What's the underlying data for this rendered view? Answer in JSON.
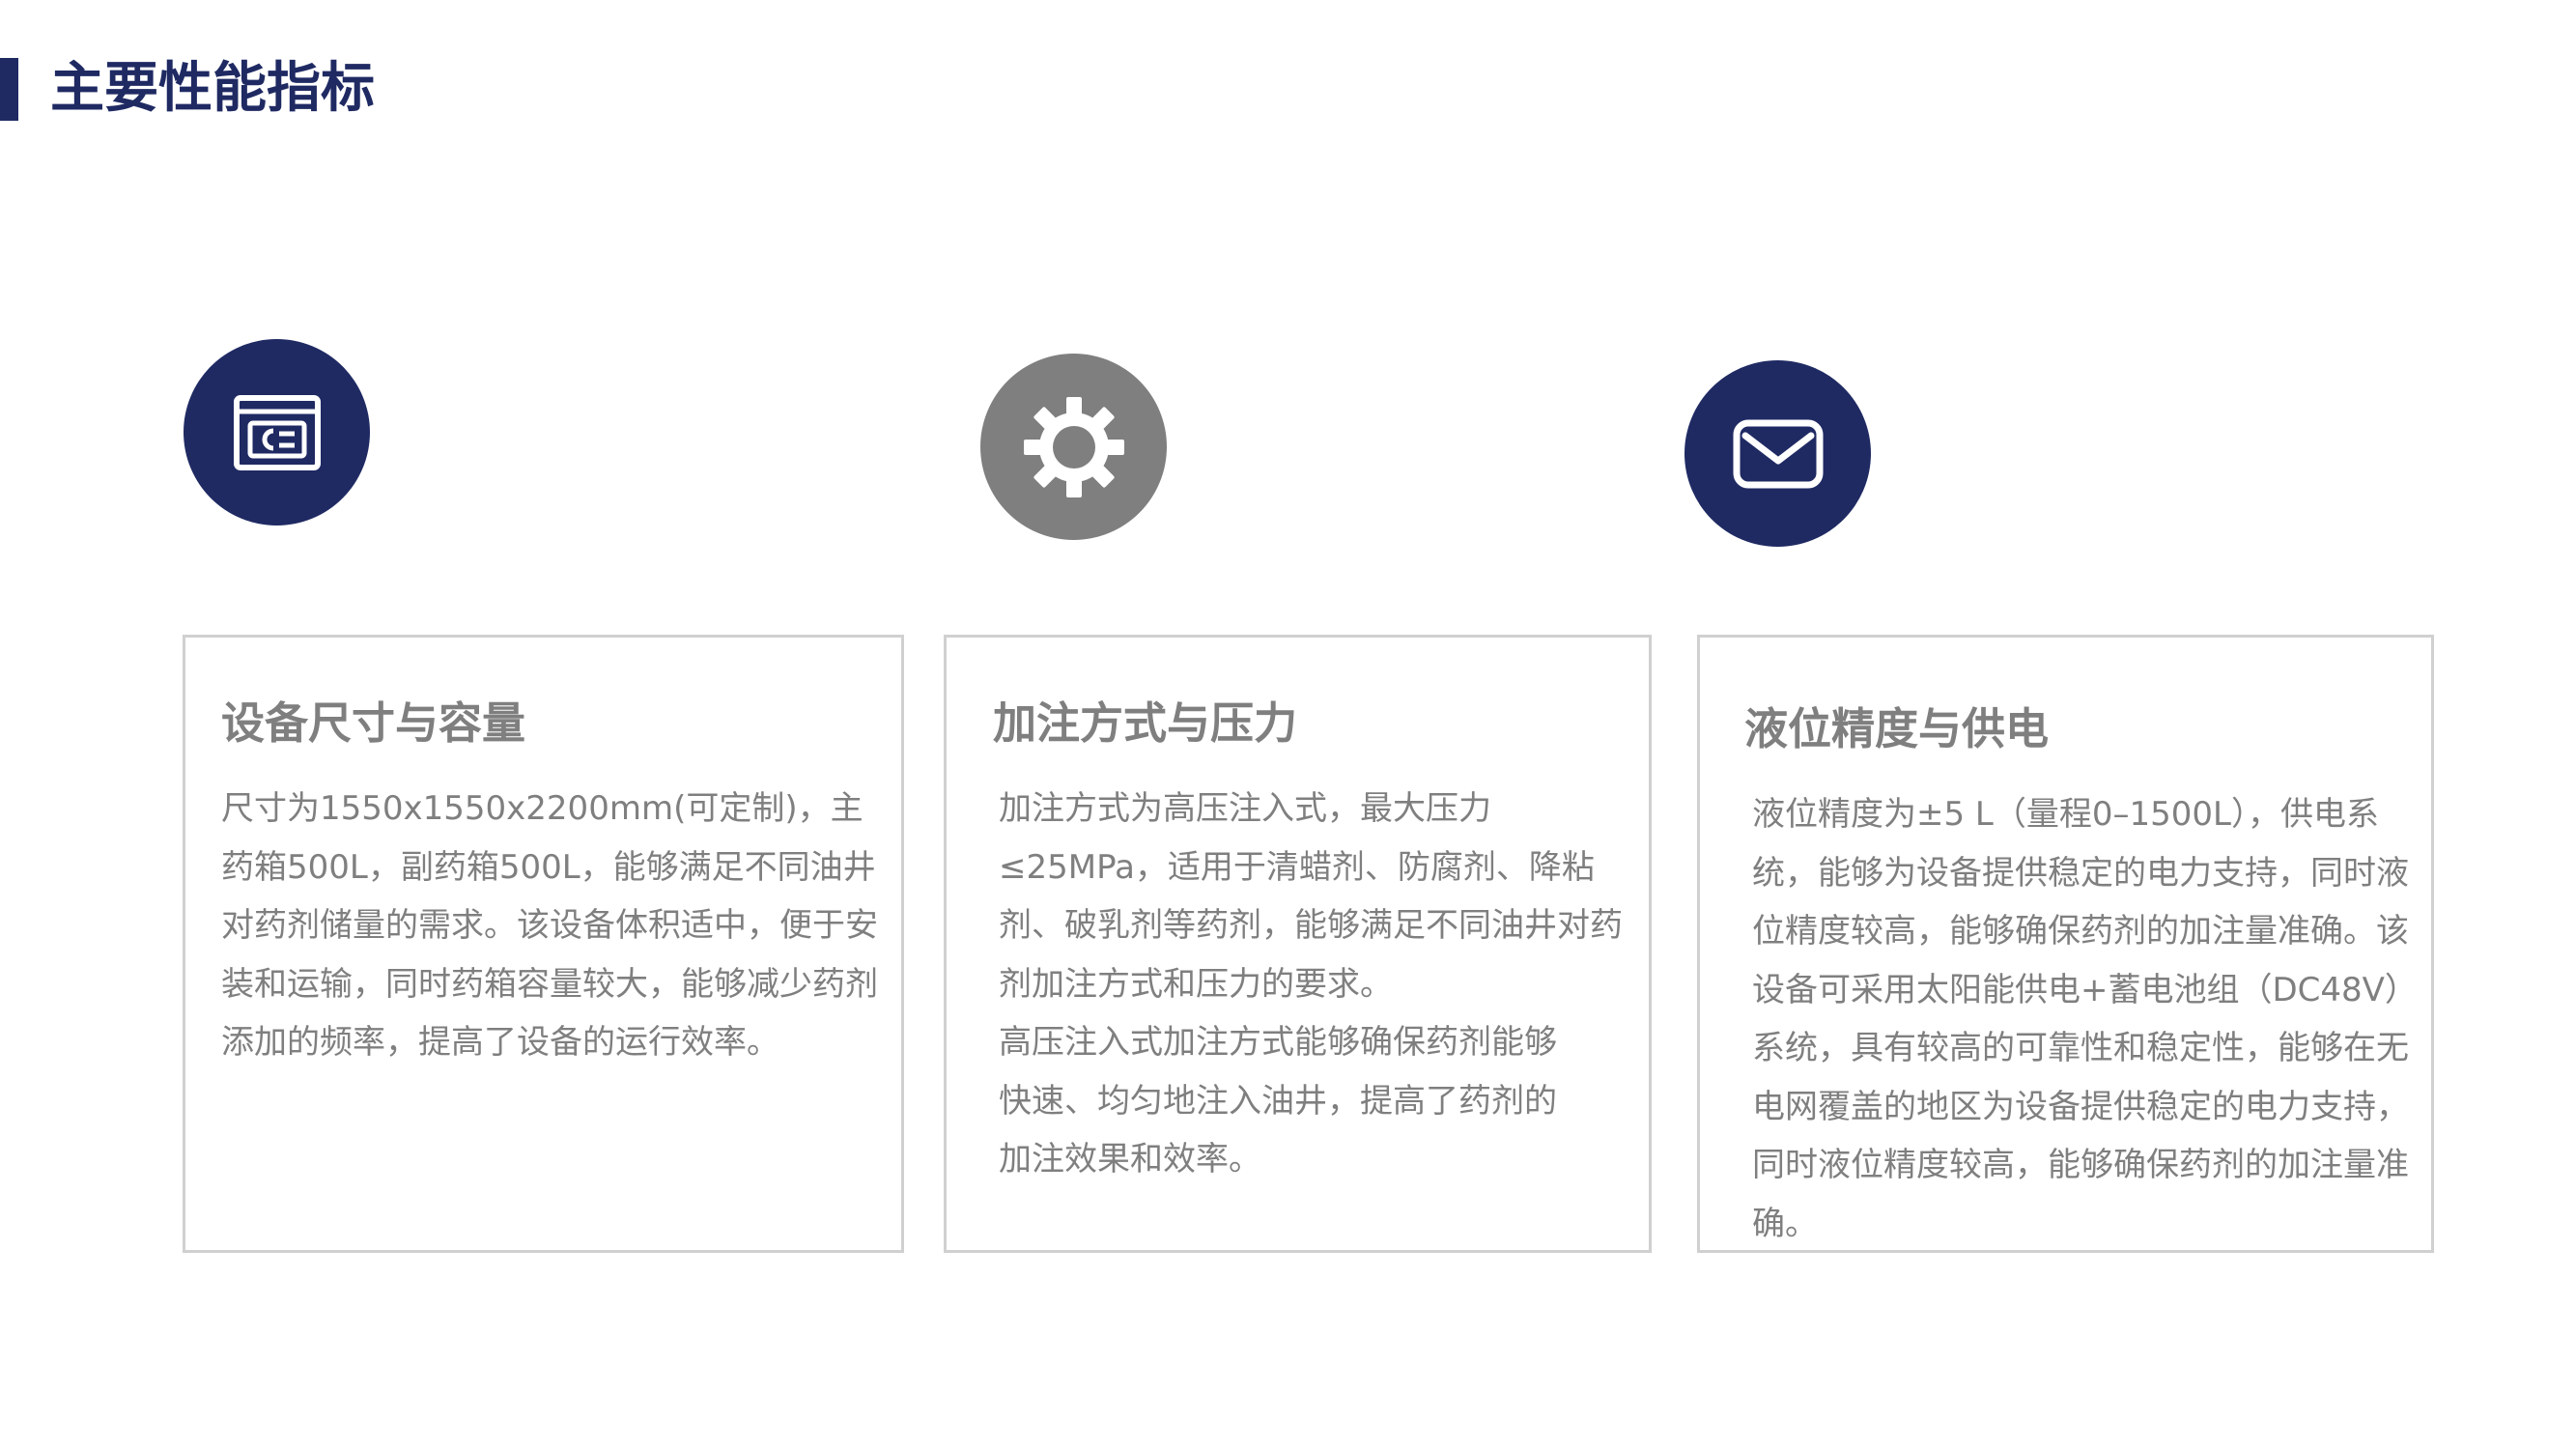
{
  "page": {
    "title": "主要性能指标"
  },
  "colors": {
    "primary": "#1f2a63",
    "secondary": "#7f7f7f",
    "border": "#d0d0d0",
    "text": "#7f7f7f"
  },
  "cards": [
    {
      "icon": "id-card-icon",
      "title": "设备尺寸与容量",
      "paragraphs": [
        "尺寸为1550x1550x2200mm(可定制)，主药箱500L，副药箱500L，能够满足不同油井对药剂储量的需求。该设备体积适中，便于安装和运输，同时药箱容量较大，能够减少药剂添加的频率，提高了设备的运行效率。"
      ]
    },
    {
      "icon": "gear-icon",
      "title": "加注方式与压力",
      "paragraphs": [
        "加注方式为高压注入式，最大压力≤25MPa，适用于清蜡剂、防腐剂、降粘剂、破乳剂等药剂，能够满足不同油井对药剂加注方式和压力的要求。",
        "高压注入式加注方式能够确保药剂能够快速、均匀地注入油井，提高了药剂的加注效果和效率。"
      ]
    },
    {
      "icon": "envelope-icon",
      "title": "液位精度与供电",
      "paragraphs": [
        "液位精度为±5 L（量程0–1500L），供电系统，能够为设备提供稳定的电力支持，同时液位精度较高，能够确保药剂的加注量准确。该设备可采用太阳能供电+蓄电池组（DC48V）系统，具有较高的可靠性和稳定性，能够在无电网覆盖的地区为设备提供稳定的电力支持，同时液位精度较高，能够确保药剂的加注量准确。"
      ]
    }
  ]
}
